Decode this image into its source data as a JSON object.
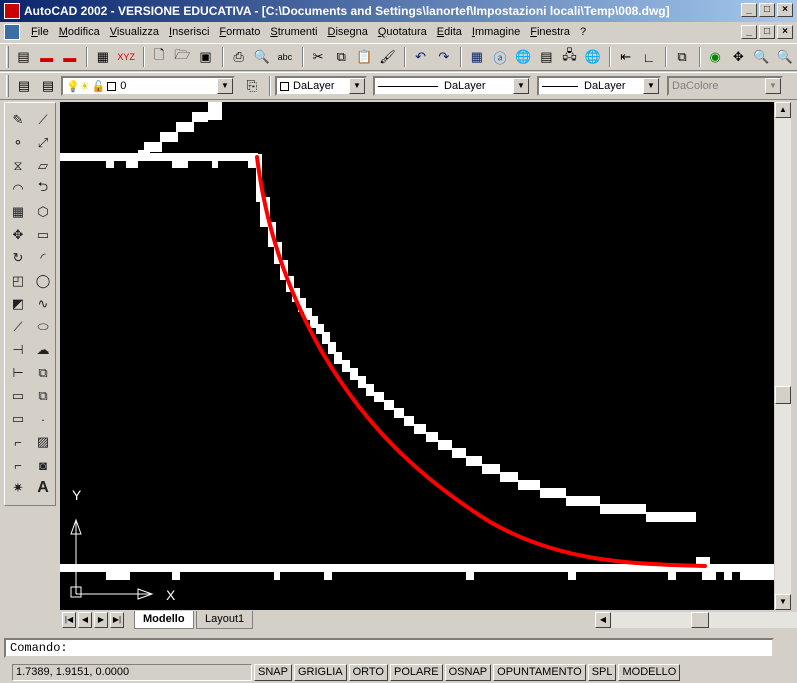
{
  "window": {
    "title": "AutoCAD 2002 - VERSIONE EDUCATIVA - [C:\\Documents and Settings\\lanortef\\Impostazioni locali\\Temp\\008.dwg]",
    "controls": [
      "_",
      "□",
      "×"
    ],
    "doc_controls": [
      "_",
      "□",
      "×"
    ]
  },
  "menu": [
    "File",
    "Modifica",
    "Visualizza",
    "Inserisci",
    "Formato",
    "Strumenti",
    "Disegna",
    "Quotatura",
    "Edita",
    "Immagine",
    "Finestra",
    "?"
  ],
  "properties": {
    "layer_value": "0",
    "color_value": "DaLayer",
    "linetype_value": "DaLayer",
    "lineweight_value": "DaLayer",
    "plotstyle_value": "DaColore"
  },
  "ucs": {
    "y_label": "Y",
    "x_label": "X"
  },
  "tabs": [
    "Modello",
    "Layout1"
  ],
  "command": {
    "prompt": "Comando:"
  },
  "status": {
    "coords": "1.7389, 1.9151, 0.0000",
    "buttons": [
      "SNAP",
      "GRIGLIA",
      "ORTO",
      "POLARE",
      "OSNAP",
      "OPUNTAMENTO",
      "SPL",
      "MODELLO"
    ]
  },
  "colors": {
    "title_start": "#0a246a",
    "title_end": "#a6caf0",
    "canvas": "#000000",
    "curve": "#ff0000",
    "pixels": "#ffffff"
  }
}
